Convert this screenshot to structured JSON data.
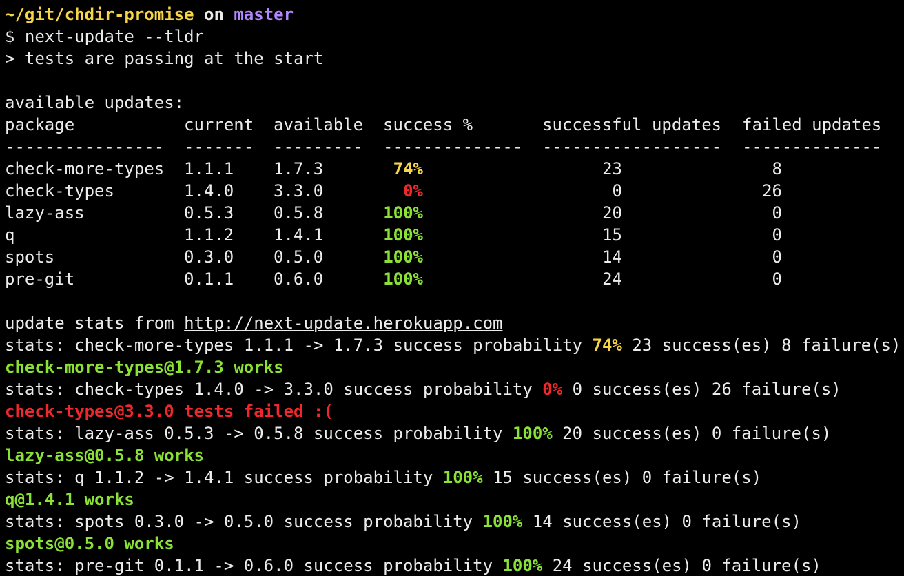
{
  "prompt": {
    "path": "~/git/chdir-promise",
    "on": " on ",
    "branch": "master",
    "command": "$ next-update --tldr"
  },
  "intro": "> tests are passing at the start",
  "available_label": "available updates:",
  "table": {
    "headers": [
      "package",
      "current",
      "available",
      "success %",
      "successful updates",
      "failed updates"
    ],
    "dashes": [
      "----------------",
      "-------",
      "---------",
      "--------------",
      "------------------",
      "--------------"
    ],
    "rows": [
      {
        "package": "check-more-types",
        "current": "1.1.1",
        "available": "1.7.3",
        "success": "74%",
        "successful": "23",
        "failed": "8"
      },
      {
        "package": "check-types",
        "current": "1.4.0",
        "available": "3.3.0",
        "success": "0%",
        "successful": "0",
        "failed": "26"
      },
      {
        "package": "lazy-ass",
        "current": "0.5.3",
        "available": "0.5.8",
        "success": "100%",
        "successful": "20",
        "failed": "0"
      },
      {
        "package": "q",
        "current": "1.1.2",
        "available": "1.4.1",
        "success": "100%",
        "successful": "15",
        "failed": "0"
      },
      {
        "package": "spots",
        "current": "0.3.0",
        "available": "0.5.0",
        "success": "100%",
        "successful": "14",
        "failed": "0"
      },
      {
        "package": "pre-git",
        "current": "0.1.1",
        "available": "0.6.0",
        "success": "100%",
        "successful": "24",
        "failed": "0"
      }
    ]
  },
  "stats_from": {
    "prefix": "update stats from ",
    "url": "http://next-update.herokuapp.com"
  },
  "log": [
    {
      "pre": "stats: check-more-types 1.1.1 -> 1.7.3 success probability ",
      "pct": "74%",
      "post": " 23 success(es) 8 failure(s)"
    },
    {
      "result": "check-more-types@1.7.3 works"
    },
    {
      "pre": "stats: check-types 1.4.0 -> 3.3.0 success probability ",
      "pct": "0%",
      "post": " 0 success(es) 26 failure(s)"
    },
    {
      "result": "check-types@3.3.0 tests failed :("
    },
    {
      "pre": "stats: lazy-ass 0.5.3 -> 0.5.8 success probability ",
      "pct": "100%",
      "post": " 20 success(es) 0 failure(s)"
    },
    {
      "result": "lazy-ass@0.5.8 works"
    },
    {
      "pre": "stats: q 1.1.2 -> 1.4.1 success probability ",
      "pct": "100%",
      "post": " 15 success(es) 0 failure(s)"
    },
    {
      "result": "q@1.4.1 works"
    },
    {
      "pre": "stats: spots 0.3.0 -> 0.5.0 success probability ",
      "pct": "100%",
      "post": " 14 success(es) 0 failure(s)"
    },
    {
      "result": "spots@0.5.0 works"
    },
    {
      "pre": "stats: pre-git 0.1.1 -> 0.6.0 success probability ",
      "pct": "100%",
      "post": " 24 success(es) 0 failure(s)"
    }
  ],
  "colors": {
    "background": "#000000",
    "text": "#ececec",
    "yellow": "#f7d548",
    "red": "#f0282d",
    "green": "#8ae234",
    "purple": "#b388ff"
  }
}
